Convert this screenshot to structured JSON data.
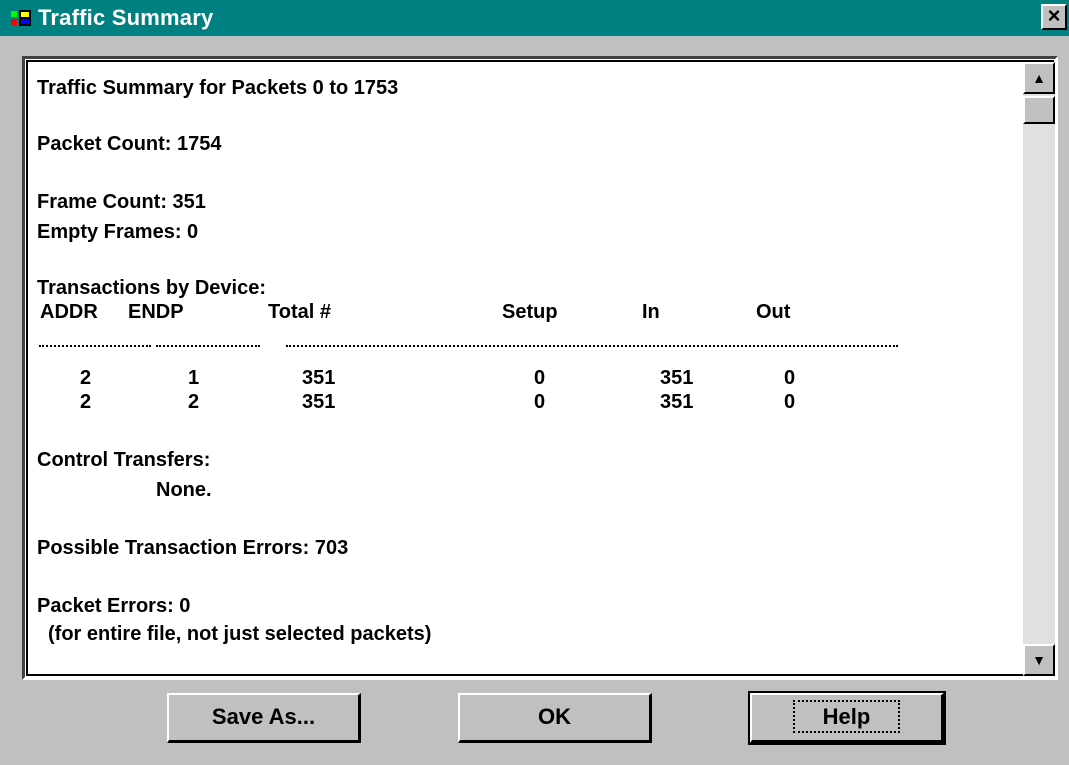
{
  "window": {
    "title": "Traffic Summary",
    "close_glyph": "×",
    "title_icon": "multimedia-app-icon"
  },
  "summary": {
    "heading": "Traffic Summary for Packets 0 to 1753",
    "packet_count": "Packet Count: 1754",
    "frame_count": "Frame Count: 351",
    "empty_frames": "Empty Frames: 0",
    "transactions_heading": "Transactions by Device:",
    "table": {
      "headers": [
        "ADDR",
        "ENDP",
        "Total #",
        "Setup",
        "In",
        "Out"
      ],
      "rows": [
        [
          "2",
          "1",
          "351",
          "0",
          "351",
          "0"
        ],
        [
          "2",
          "2",
          "351",
          "0",
          "351",
          "0"
        ]
      ]
    },
    "control_transfers_heading": "Control Transfers:",
    "control_transfers_value": "None.",
    "possible_errors": "Possible Transaction Errors: 703",
    "packet_errors": "Packet Errors: 0",
    "packet_errors_note": "(for entire file, not just selected packets)"
  },
  "buttons": {
    "save_as": "Save As...",
    "ok": "OK",
    "help": "Help"
  },
  "scrollbar": {
    "up_glyph": "▲",
    "down_glyph": "▼"
  }
}
